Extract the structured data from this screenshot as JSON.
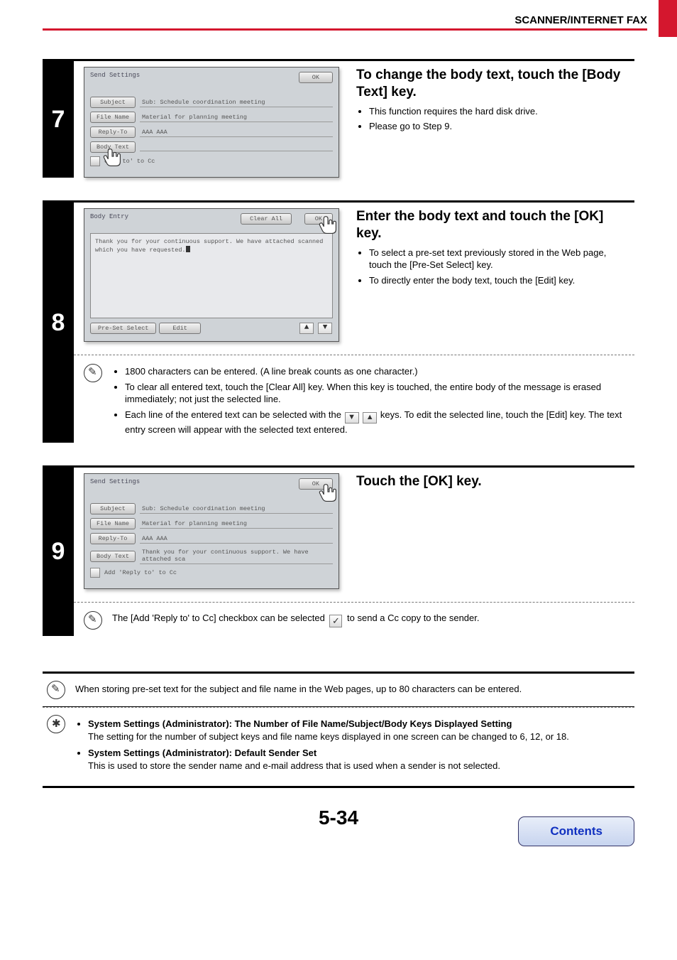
{
  "header": {
    "section_title": "SCANNER/INTERNET FAX"
  },
  "step7": {
    "number": "7",
    "heading": "To change the body text, touch the [Body Text] key.",
    "bullets": [
      "This function requires the hard disk drive.",
      "Please go to Step 9."
    ],
    "panel": {
      "title": "Send Settings",
      "ok": "OK",
      "labels": {
        "subject": "Subject",
        "file_name": "File Name",
        "reply_to": "Reply-To",
        "body_text": "Body Text"
      },
      "values": {
        "subject": "Sub: Schedule coordination meeting",
        "file_name": "Material for planning meeting",
        "reply_to": "AAA AAA",
        "body_text": ""
      },
      "cc_label": "eply to' to Cc"
    }
  },
  "step8": {
    "number": "8",
    "heading": "Enter the body text and touch the [OK] key.",
    "bullets": [
      "To select a pre-set text previously stored in the Web page, touch the [Pre-Set Select] key.",
      "To directly enter the body text, touch the [Edit] key."
    ],
    "panel": {
      "title": "Body Entry",
      "clear_all": "Clear All",
      "ok": "OK",
      "body_text": "Thank you for your continuous support. We have attached scanned which you have requested.",
      "preset": "Pre-Set Select",
      "edit": "Edit"
    },
    "tips": [
      "1800 characters can be entered. (A line break counts as one character.)",
      "To clear all entered text, touch the [Clear All] key. When this key is touched, the entire body of the message is erased immediately; not just the selected line.",
      "Each line of the entered text can be selected with the ▼ ▲ keys. To edit the selected line, touch the [Edit] key. The text entry screen will appear with the selected text entered."
    ],
    "tip3_prefix": "Each line of the entered text can be selected with the  ",
    "tip3_suffix": "  keys. To edit the selected line, touch the [Edit] key. The text entry screen will appear with the selected text entered."
  },
  "step9": {
    "number": "9",
    "heading": "Touch the [OK] key.",
    "panel": {
      "title": "Send Settings",
      "ok": "OK",
      "labels": {
        "subject": "Subject",
        "file_name": "File Name",
        "reply_to": "Reply-To",
        "body_text": "Body Text"
      },
      "values": {
        "subject": "Sub: Schedule coordination meeting",
        "file_name": "Material for planning meeting",
        "reply_to": "AAA AAA",
        "body_text": "Thank you for your continuous support. We have attached sca"
      },
      "cc_label": "Add 'Reply to' to Cc"
    },
    "tip_prefix": "The [Add 'Reply to' to Cc] checkbox can be selected  ",
    "tip_suffix": "  to send a Cc copy to the sender."
  },
  "note": "When storing pre-set text for the subject and file name in the Web pages, up to 80 characters can be entered.",
  "admin": {
    "item1_title": "System Settings (Administrator): The Number of File Name/Subject/Body Keys Displayed Setting",
    "item1_body": "The setting for the number of subject keys and file name keys displayed in one screen can be changed to 6, 12, or 18.",
    "item2_title": "System Settings (Administrator): Default Sender Set",
    "item2_body": "This is used to store the sender name and e-mail address that is used when a sender is not selected."
  },
  "footer": {
    "page_number": "5-34",
    "contents": "Contents"
  },
  "glyphs": {
    "down": "▼",
    "up": "▲",
    "check": "✓"
  }
}
